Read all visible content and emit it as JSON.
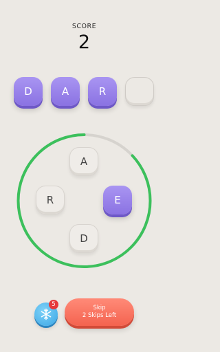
{
  "score": {
    "label": "SCORE",
    "value": "2"
  },
  "slots": [
    {
      "letter": "D",
      "filled": true
    },
    {
      "letter": "A",
      "filled": true
    },
    {
      "letter": "R",
      "filled": true
    },
    {
      "letter": "",
      "filled": false
    }
  ],
  "tiles": {
    "top": "A",
    "left": "R",
    "right": "E",
    "bottom": "D"
  },
  "timer": {
    "remaining_fraction": 0.87,
    "color": "#3cc05c",
    "track_color": "#d6d3ce"
  },
  "powerup": {
    "icon": "snowflake-icon",
    "count": "5"
  },
  "skip": {
    "label": "Skip",
    "sublabel": "2 Skips Left"
  }
}
